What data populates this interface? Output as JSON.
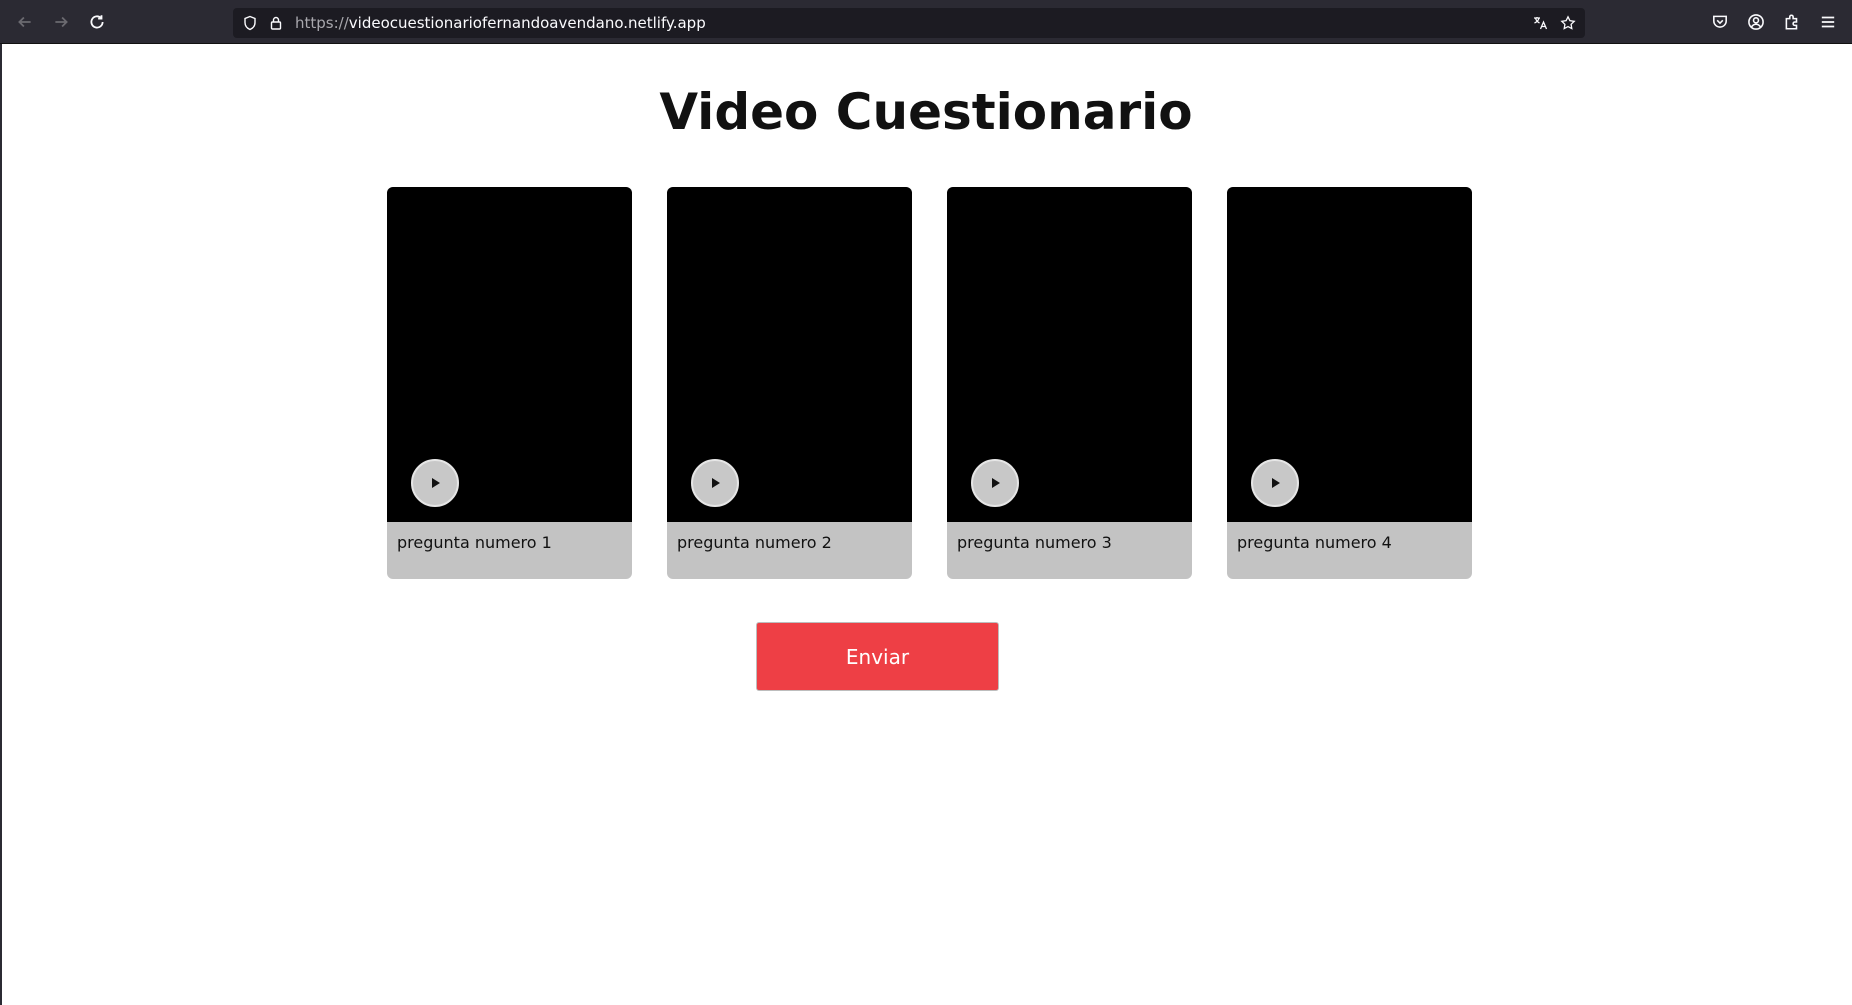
{
  "browser": {
    "url_scheme": "https://",
    "url_host": "videocuestionariofernandoavendano.netlify.app",
    "icons": [
      "back-icon",
      "forward-icon",
      "reload-icon",
      "shield-icon",
      "lock-icon",
      "translate-icon",
      "bookmark-star-icon",
      "pocket-icon",
      "account-icon",
      "extensions-icon",
      "menu-icon"
    ]
  },
  "page": {
    "title": "Video Cuestionario",
    "cards": [
      {
        "label": "pregunta numero 1"
      },
      {
        "label": "pregunta numero 2"
      },
      {
        "label": "pregunta numero 3"
      },
      {
        "label": "pregunta numero 4"
      }
    ],
    "submit_label": "Enviar"
  },
  "colors": {
    "toolbar": "#2b2a33",
    "urlbar": "#1c1b22",
    "card": "#c3c3c3",
    "video": "#000000",
    "submit": "#ee3f45"
  }
}
